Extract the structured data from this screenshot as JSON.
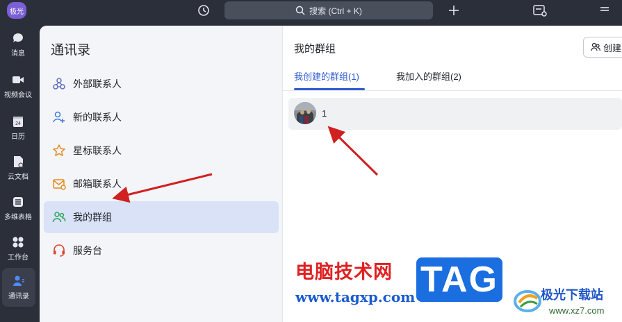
{
  "topbar": {
    "user_avatar_text": "极光",
    "search_placeholder": "搜索 (Ctrl + K)"
  },
  "rail": {
    "items": [
      {
        "label": "消息",
        "icon": "chat-icon"
      },
      {
        "label": "视频会议",
        "icon": "video-icon"
      },
      {
        "label": "日历",
        "icon": "calendar-icon",
        "badge": "24"
      },
      {
        "label": "云文档",
        "icon": "cloud-doc-icon"
      },
      {
        "label": "多维表格",
        "icon": "table-icon"
      },
      {
        "label": "工作台",
        "icon": "grid-icon"
      },
      {
        "label": "通讯录",
        "icon": "contacts-icon",
        "active": true
      }
    ]
  },
  "contacts": {
    "title": "通讯录",
    "items": [
      {
        "label": "外部联系人",
        "icon": "external-contacts-icon"
      },
      {
        "label": "新的联系人",
        "icon": "new-contact-icon"
      },
      {
        "label": "星标联系人",
        "icon": "star-icon"
      },
      {
        "label": "邮箱联系人",
        "icon": "mail-contact-icon"
      },
      {
        "label": "我的群组",
        "icon": "group-icon",
        "selected": true
      },
      {
        "label": "服务台",
        "icon": "headset-icon"
      }
    ]
  },
  "main": {
    "title": "我的群组",
    "create_button": "创建",
    "tabs": [
      {
        "label": "我创建的群组(1)",
        "active": true
      },
      {
        "label": "我加入的群组(2)",
        "active": false
      }
    ],
    "groups": [
      {
        "name": "1"
      }
    ]
  },
  "watermark": {
    "site_name": "电脑技术网",
    "site_url": "www.tagxp.com",
    "tag": "TAG",
    "logo_name": "极光下载站",
    "logo_url": "www.xz7.com"
  },
  "colors": {
    "accent": "#2f5bd3",
    "rail_bg": "#2b2f3a",
    "selected_bg": "#d9e2f6",
    "arrow": "#d02020"
  }
}
